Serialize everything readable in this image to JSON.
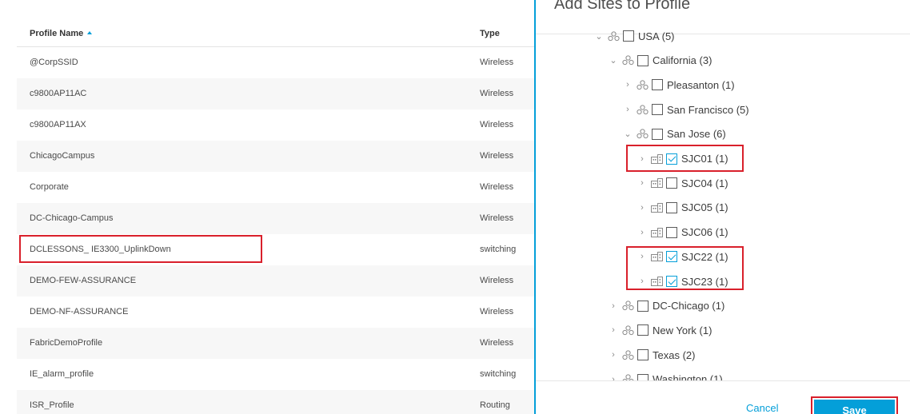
{
  "profiles": {
    "columns": {
      "name": "Profile Name",
      "type": "Type"
    },
    "rows": [
      {
        "name": "@CorpSSID",
        "type": "Wireless"
      },
      {
        "name": "c9800AP11AC",
        "type": "Wireless"
      },
      {
        "name": "c9800AP11AX",
        "type": "Wireless"
      },
      {
        "name": "ChicagoCampus",
        "type": "Wireless"
      },
      {
        "name": "Corporate",
        "type": "Wireless"
      },
      {
        "name": "DC-Chicago-Campus",
        "type": "Wireless"
      },
      {
        "name": "DCLESSONS_ IE3300_UplinkDown",
        "type": "switching"
      },
      {
        "name": "DEMO-FEW-ASSURANCE",
        "type": "Wireless"
      },
      {
        "name": "DEMO-NF-ASSURANCE",
        "type": "Wireless"
      },
      {
        "name": "FabricDemoProfile",
        "type": "Wireless"
      },
      {
        "name": "IE_alarm_profile",
        "type": "switching"
      },
      {
        "name": "ISR_Profile",
        "type": "Routing"
      }
    ]
  },
  "drawer": {
    "title": "Add Sites to Profile",
    "tree": [
      {
        "id": "usa",
        "label": "USA (5)",
        "kind": "area",
        "expanded": true,
        "checked": false
      },
      {
        "id": "california",
        "label": "California (3)",
        "kind": "area",
        "expanded": true,
        "checked": false
      },
      {
        "id": "pleasanton",
        "label": "Pleasanton (1)",
        "kind": "area",
        "expanded": false,
        "checked": false
      },
      {
        "id": "san-francisco",
        "label": "San Francisco (5)",
        "kind": "area",
        "expanded": false,
        "checked": false
      },
      {
        "id": "san-jose",
        "label": "San Jose (6)",
        "kind": "area",
        "expanded": true,
        "checked": false
      },
      {
        "id": "sjc01",
        "label": "SJC01 (1)",
        "kind": "building",
        "expanded": false,
        "checked": true
      },
      {
        "id": "sjc04",
        "label": "SJC04 (1)",
        "kind": "building",
        "expanded": false,
        "checked": false
      },
      {
        "id": "sjc05",
        "label": "SJC05 (1)",
        "kind": "building",
        "expanded": false,
        "checked": false
      },
      {
        "id": "sjc06",
        "label": "SJC06 (1)",
        "kind": "building",
        "expanded": false,
        "checked": false
      },
      {
        "id": "sjc22",
        "label": "SJC22 (1)",
        "kind": "building",
        "expanded": false,
        "checked": true
      },
      {
        "id": "sjc23",
        "label": "SJC23 (1)",
        "kind": "building",
        "expanded": false,
        "checked": true
      },
      {
        "id": "dc-chicago",
        "label": "DC-Chicago (1)",
        "kind": "area",
        "expanded": false,
        "checked": false
      },
      {
        "id": "new-york",
        "label": "New York (1)",
        "kind": "area",
        "expanded": false,
        "checked": false
      },
      {
        "id": "texas",
        "label": "Texas (2)",
        "kind": "area",
        "expanded": false,
        "checked": false
      },
      {
        "id": "washington",
        "label": "Washington (1)",
        "kind": "area",
        "expanded": false,
        "checked": false
      }
    ],
    "cancel_label": "Cancel",
    "save_label": "Save"
  },
  "colors": {
    "accent": "#049fd9",
    "highlight": "#d9202b"
  },
  "icons": {
    "area": "site-area-icon",
    "building": "building-icon",
    "sort": "sort-ascending-icon"
  }
}
